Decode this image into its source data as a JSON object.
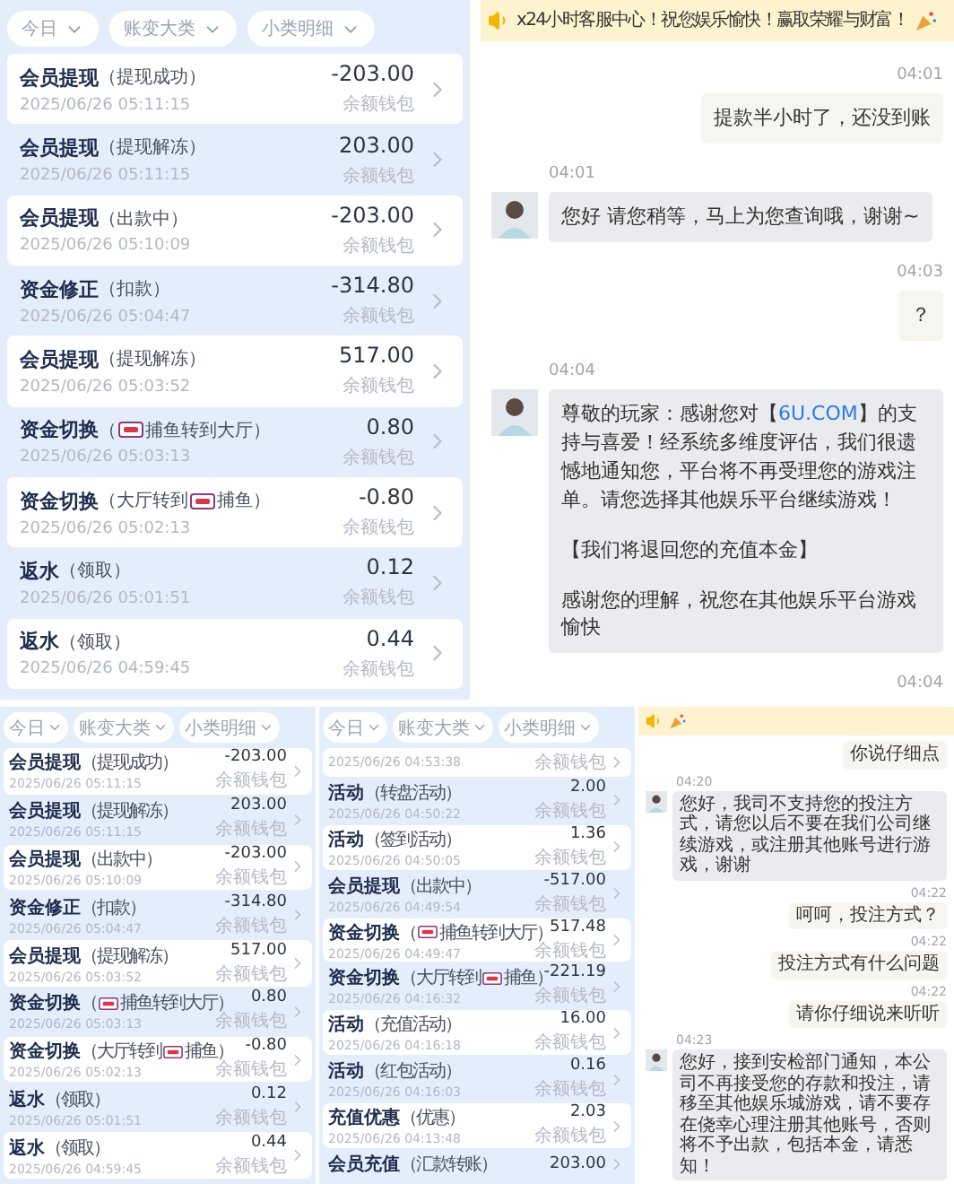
{
  "top_row": [
    {
      "kind": "ledger",
      "filters": [
        "今日",
        "账变大类",
        "小类明细"
      ],
      "rows": [
        {
          "title": "会员提现",
          "detail": [
            "（提现成功）"
          ],
          "time": "2025/06/26 05:11:15",
          "amount": "-203.00",
          "wallet": "余额钱包"
        },
        {
          "title": "会员提现",
          "detail": [
            "（提现解冻）"
          ],
          "time": "2025/06/26 05:11:15",
          "amount": "203.00",
          "wallet": "余额钱包"
        },
        {
          "title": "会员提现",
          "detail": [
            "（出款中）"
          ],
          "time": "2025/06/26 05:10:09",
          "amount": "-203.00",
          "wallet": "余额钱包"
        },
        {
          "title": "资金修正",
          "detail": [
            "（扣款）"
          ],
          "time": "2025/06/26 05:04:47",
          "amount": "-314.80",
          "wallet": "余额钱包"
        },
        {
          "title": "会员提现",
          "detail": [
            "（提现解冻）"
          ],
          "time": "2025/06/26 05:03:52",
          "amount": "517.00",
          "wallet": "余额钱包"
        },
        {
          "title": "资金切换",
          "detail": [
            "（",
            "捕鱼转到大厅）"
          ],
          "time": "2025/06/26 05:03:13",
          "amount": "0.80",
          "wallet": "余额钱包"
        },
        {
          "title": "资金切换",
          "detail": [
            "（大厅转到",
            "捕鱼）"
          ],
          "time": "2025/06/26 05:02:13",
          "amount": "-0.80",
          "wallet": "余额钱包"
        },
        {
          "title": "返水",
          "detail": [
            "（领取）"
          ],
          "time": "2025/06/26 05:01:51",
          "amount": "0.12",
          "wallet": "余额钱包"
        },
        {
          "title": "返水",
          "detail": [
            "（领取）"
          ],
          "time": "2025/06/26 04:59:45",
          "amount": "0.44",
          "wallet": "余额钱包"
        }
      ]
    },
    {
      "kind": "chat",
      "banner": {
        "text": "x24小时客服中心！祝您娱乐愉快！赢取荣耀与财富！"
      },
      "messages": [
        {
          "kind": "outgoing",
          "time": "04:01",
          "paragraphs": [
            "提款半小时了，还没到账"
          ]
        },
        {
          "kind": "incoming",
          "time": "04:01",
          "paragraphs": [
            "您好 请您稍等，马上为您查询哦，谢谢~"
          ]
        },
        {
          "kind": "outgoing",
          "time": "04:03",
          "paragraphs": [
            "？"
          ]
        },
        {
          "kind": "incoming",
          "time": "04:04",
          "paragraphs": [
            {
              "before": "尊敬的玩家：感谢您对【",
              "link": "6U.COM",
              "after": "】的支持与喜爱！经系统多维度评估，我们很遗憾地通知您，平台将不再受理您的游戏注单。请您选择其他娱乐平台继续游戏！"
            },
            "【我们将退回您的充值本金】",
            "感谢您的理解，祝您在其他娱乐平台游戏愉快"
          ]
        },
        {
          "kind": "outgoing",
          "time": "04:04"
        }
      ]
    }
  ],
  "bottom_row": [
    {
      "kind": "ledger",
      "filters": [
        "今日",
        "账变大类",
        "小类明细"
      ],
      "rows": [
        {
          "title": "会员提现",
          "detail": [
            "（提现成功）"
          ],
          "time": "2025/06/26 05:11:15",
          "amount": "-203.00",
          "wallet": "余额钱包"
        },
        {
          "title": "会员提现",
          "detail": [
            "（提现解冻）"
          ],
          "time": "2025/06/26 05:11:15",
          "amount": "203.00",
          "wallet": "余额钱包"
        },
        {
          "title": "会员提现",
          "detail": [
            "（出款中）"
          ],
          "time": "2025/06/26 05:10:09",
          "amount": "-203.00",
          "wallet": "余额钱包"
        },
        {
          "title": "资金修正",
          "detail": [
            "（扣款）"
          ],
          "time": "2025/06/26 05:04:47",
          "amount": "-314.80",
          "wallet": "余额钱包"
        },
        {
          "title": "会员提现",
          "detail": [
            "（提现解冻）"
          ],
          "time": "2025/06/26 05:03:52",
          "amount": "517.00",
          "wallet": "余额钱包"
        },
        {
          "title": "资金切换",
          "detail": [
            "（",
            "捕鱼转到大厅）"
          ],
          "time": "2025/06/26 05:03:13",
          "amount": "0.80",
          "wallet": "余额钱包"
        },
        {
          "title": "资金切换",
          "detail": [
            "（大厅转到",
            "捕鱼）"
          ],
          "time": "2025/06/26 05:02:13",
          "amount": "-0.80",
          "wallet": "余额钱包"
        },
        {
          "title": "返水",
          "detail": [
            "（领取）"
          ],
          "time": "2025/06/26 05:01:51",
          "amount": "0.12",
          "wallet": "余额钱包"
        },
        {
          "title": "返水",
          "detail": [
            "（领取）"
          ],
          "time": "2025/06/26 04:59:45",
          "amount": "0.44",
          "wallet": "余额钱包"
        }
      ]
    },
    {
      "kind": "ledger",
      "filters": [
        "今日",
        "账变大类",
        "小类明细"
      ],
      "rows": [
        {
          "time": "2025/06/26 04:53:38",
          "wallet": "余额钱包"
        },
        {
          "title": "活动",
          "detail": [
            "（转盘活动）"
          ],
          "time": "2025/06/26 04:50:22",
          "amount": "2.00",
          "wallet": "余额钱包"
        },
        {
          "title": "活动",
          "detail": [
            "（签到活动）"
          ],
          "time": "2025/06/26 04:50:05",
          "amount": "1.36",
          "wallet": "余额钱包"
        },
        {
          "title": "会员提现",
          "detail": [
            "（出款中）"
          ],
          "time": "2025/06/26 04:49:54",
          "amount": "-517.00",
          "wallet": "余额钱包"
        },
        {
          "title": "资金切换",
          "detail": [
            "（",
            "捕鱼转到大厅）"
          ],
          "time": "2025/06/26 04:49:47",
          "amount": "517.48",
          "wallet": "余额钱包"
        },
        {
          "title": "资金切换",
          "detail": [
            "（大厅转到",
            "捕鱼）"
          ],
          "time": "2025/06/26 04:16:32",
          "amount": "-221.19",
          "wallet": "余额钱包"
        },
        {
          "title": "活动",
          "detail": [
            "（充值活动）"
          ],
          "time": "2025/06/26 04:16:18",
          "amount": "16.00",
          "wallet": "余额钱包"
        },
        {
          "title": "活动",
          "detail": [
            "（红包活动）"
          ],
          "time": "2025/06/26 04:16:03",
          "amount": "0.16",
          "wallet": "余额钱包"
        },
        {
          "title": "充值优惠",
          "detail": [
            "（优惠）"
          ],
          "time": "2025/06/26 04:13:48",
          "amount": "2.03",
          "wallet": "余额钱包"
        },
        {
          "title": "会员充值",
          "detail": [
            "（汇款转账）"
          ],
          "amount": "203.00"
        }
      ]
    },
    {
      "kind": "chat",
      "messages": [
        {
          "kind": "outgoing",
          "paragraphs": [
            "你说仔细点"
          ]
        },
        {
          "kind": "incoming",
          "time": "04:20",
          "paragraphs": [
            "您好，我司不支持您的投注方式，请您以后不要在我们公司继续游戏，或注册其他账号进行游戏，谢谢"
          ]
        },
        {
          "kind": "outgoing",
          "time": "04:22",
          "paragraphs": [
            "呵呵，投注方式？"
          ]
        },
        {
          "kind": "outgoing",
          "time": "04:22",
          "paragraphs": [
            "投注方式有什么问题"
          ]
        },
        {
          "kind": "outgoing",
          "time": "04:22",
          "paragraphs": [
            "请你仔细说来听听"
          ]
        },
        {
          "kind": "incoming",
          "time": "04:23",
          "paragraphs": [
            "您好，接到安检部门通知，本公司不再接受您的存款和投注，请移至其他娱乐城游戏，请不要存在侥幸心理注册其他账号，否则将不予出款，包括本金，请悉知！"
          ]
        }
      ]
    }
  ]
}
